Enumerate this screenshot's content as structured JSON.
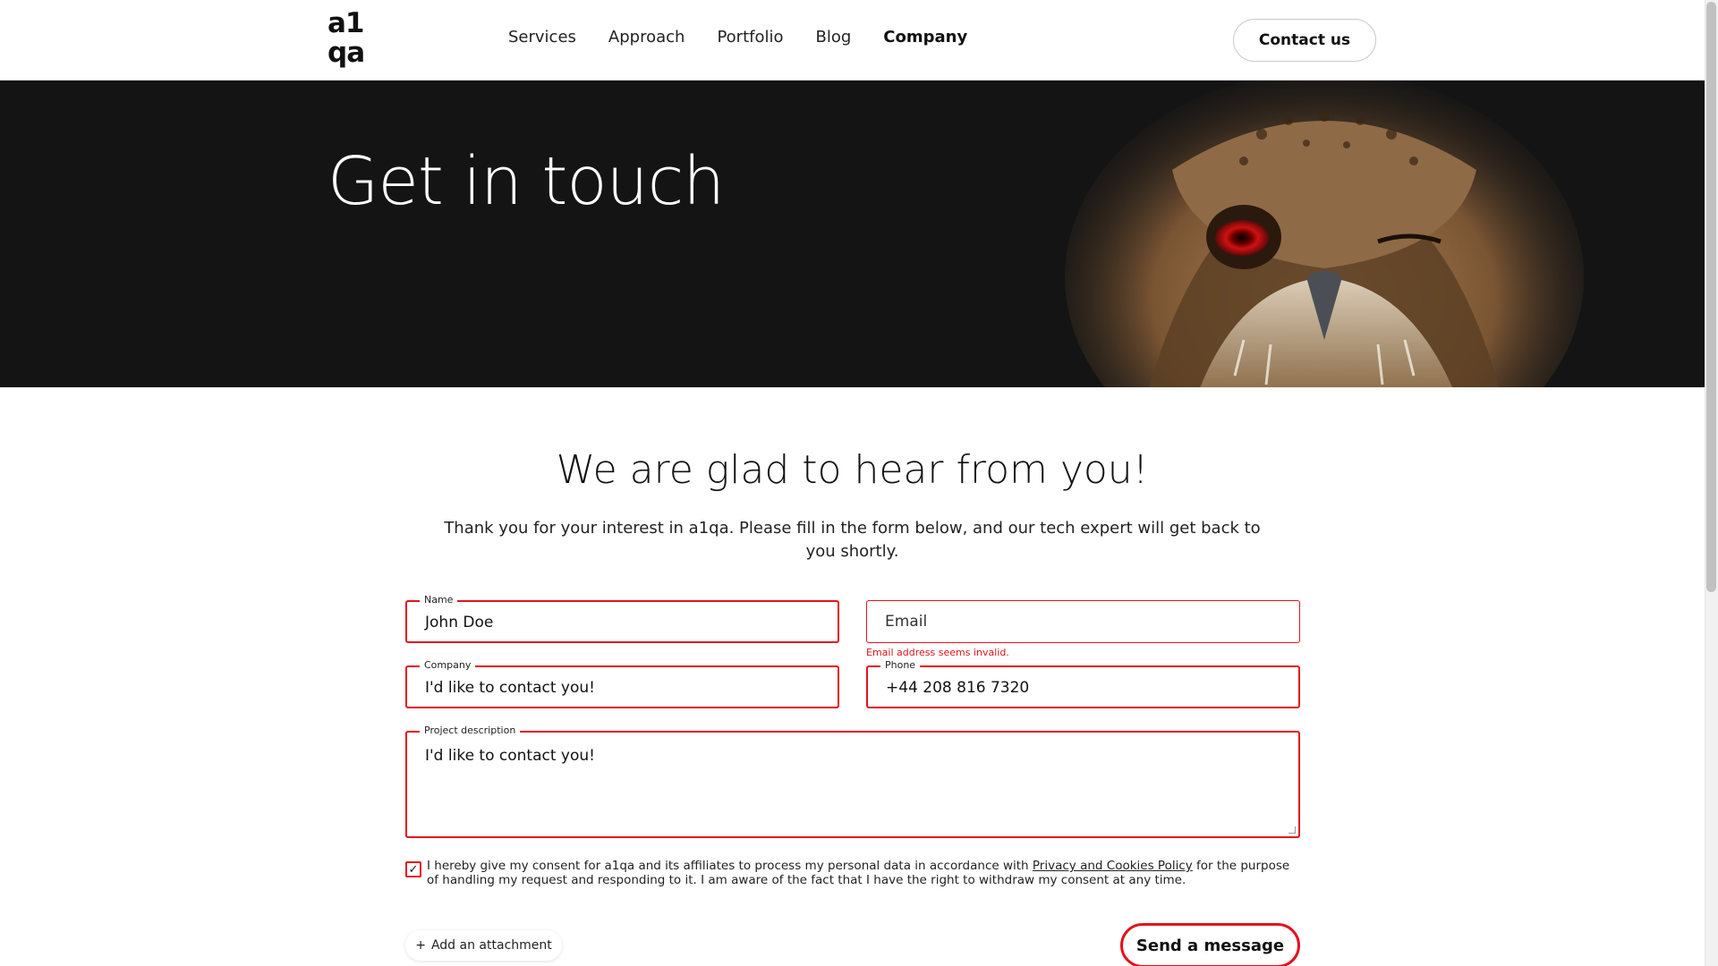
{
  "logo": {
    "line1": "a1",
    "line2": "qa"
  },
  "nav": [
    {
      "label": "Services"
    },
    {
      "label": "Approach"
    },
    {
      "label": "Portfolio"
    },
    {
      "label": "Blog"
    },
    {
      "label": "Company"
    }
  ],
  "header": {
    "contact_label": "Contact us"
  },
  "hero": {
    "title": "Get in touch",
    "image": "owl-photo"
  },
  "main": {
    "title": "We are glad to hear from you!",
    "intro": "Thank you for your interest in a1qa. Please fill in the form below, and our tech expert will get back to you shortly."
  },
  "form": {
    "name": {
      "label": "Name",
      "value": "John Doe"
    },
    "email": {
      "placeholder": "Email",
      "error": "Email address seems invalid."
    },
    "company": {
      "label": "Company",
      "value": "I'd like to contact you!"
    },
    "phone": {
      "label": "Phone",
      "value": "+44 208 816 7320"
    },
    "project": {
      "label": "Project description",
      "value": "I'd like to contact you!"
    },
    "consent": {
      "before": "I hereby give my consent for a1qa and its affiliates to process my personal data in accordance with ",
      "link": "Privacy and Cookies Policy",
      "after": " for the purpose of handling my request and responding to it. I am aware of the fact that I have the right to withdraw my consent at any time.",
      "checked": true
    },
    "attach_label": "Add an attachment",
    "send_label": "Send a message"
  },
  "colors": {
    "accent": "#e4121c",
    "hero_bg": "#141414"
  }
}
